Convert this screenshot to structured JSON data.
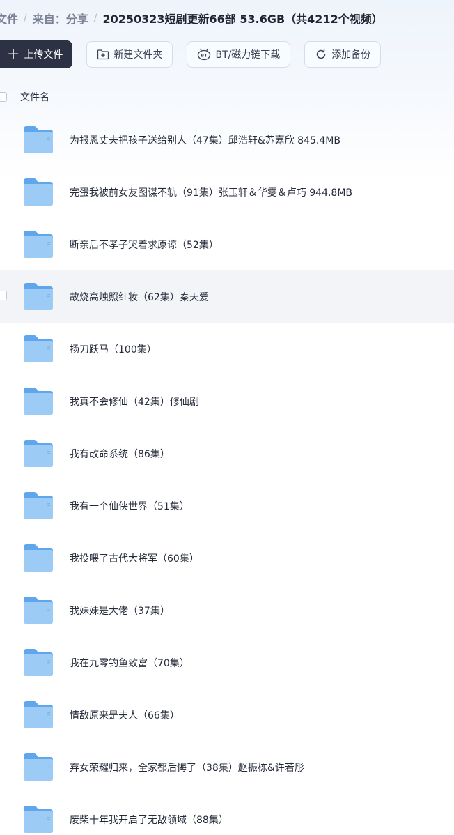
{
  "breadcrumb": {
    "root": "文件",
    "sep": "/",
    "parent": "来自：分享",
    "current": "20250323短剧更新66部 53.6GB（共4212个视频）"
  },
  "toolbar": {
    "upload_label": "上传文件",
    "upload_plus": "+",
    "new_folder_label": "新建文件夹",
    "bt_label": "BT/磁力链下载",
    "backup_label": "添加备份"
  },
  "list": {
    "header_label": "文件名",
    "items": [
      {
        "name": "为报恩丈夫把孩子送给别人（47集）邱浩轩&苏嘉欣 845.4MB"
      },
      {
        "name": "完蛋我被前女友图谋不轨（91集）张玉轩＆华雯＆卢巧  944.8MB"
      },
      {
        "name": "断亲后不孝子哭着求原谅（52集）"
      },
      {
        "name": "故烧高烛照红妆（62集）秦天爱"
      },
      {
        "name": "扬刀跃马（100集）"
      },
      {
        "name": "我真不会修仙（42集）修仙剧"
      },
      {
        "name": "我有改命系统（86集）"
      },
      {
        "name": "我有一个仙侠世界（51集）"
      },
      {
        "name": "我投喂了古代大将军（60集）"
      },
      {
        "name": "我妹妹是大佬（37集）"
      },
      {
        "name": "我在九零钓鱼致富（70集）"
      },
      {
        "name": "情敌原来是夫人（66集）"
      },
      {
        "name": "弃女荣耀归来，全家都后悔了（38集）赵振栋&许若彤"
      },
      {
        "name": "废柴十年我开启了无敌领域（88集）"
      }
    ]
  },
  "colors": {
    "primary_button": "#2c3244",
    "folder_light": "#9ccbf5",
    "folder_dark": "#5fa6ec",
    "hover_row": "#f3f4f7"
  }
}
